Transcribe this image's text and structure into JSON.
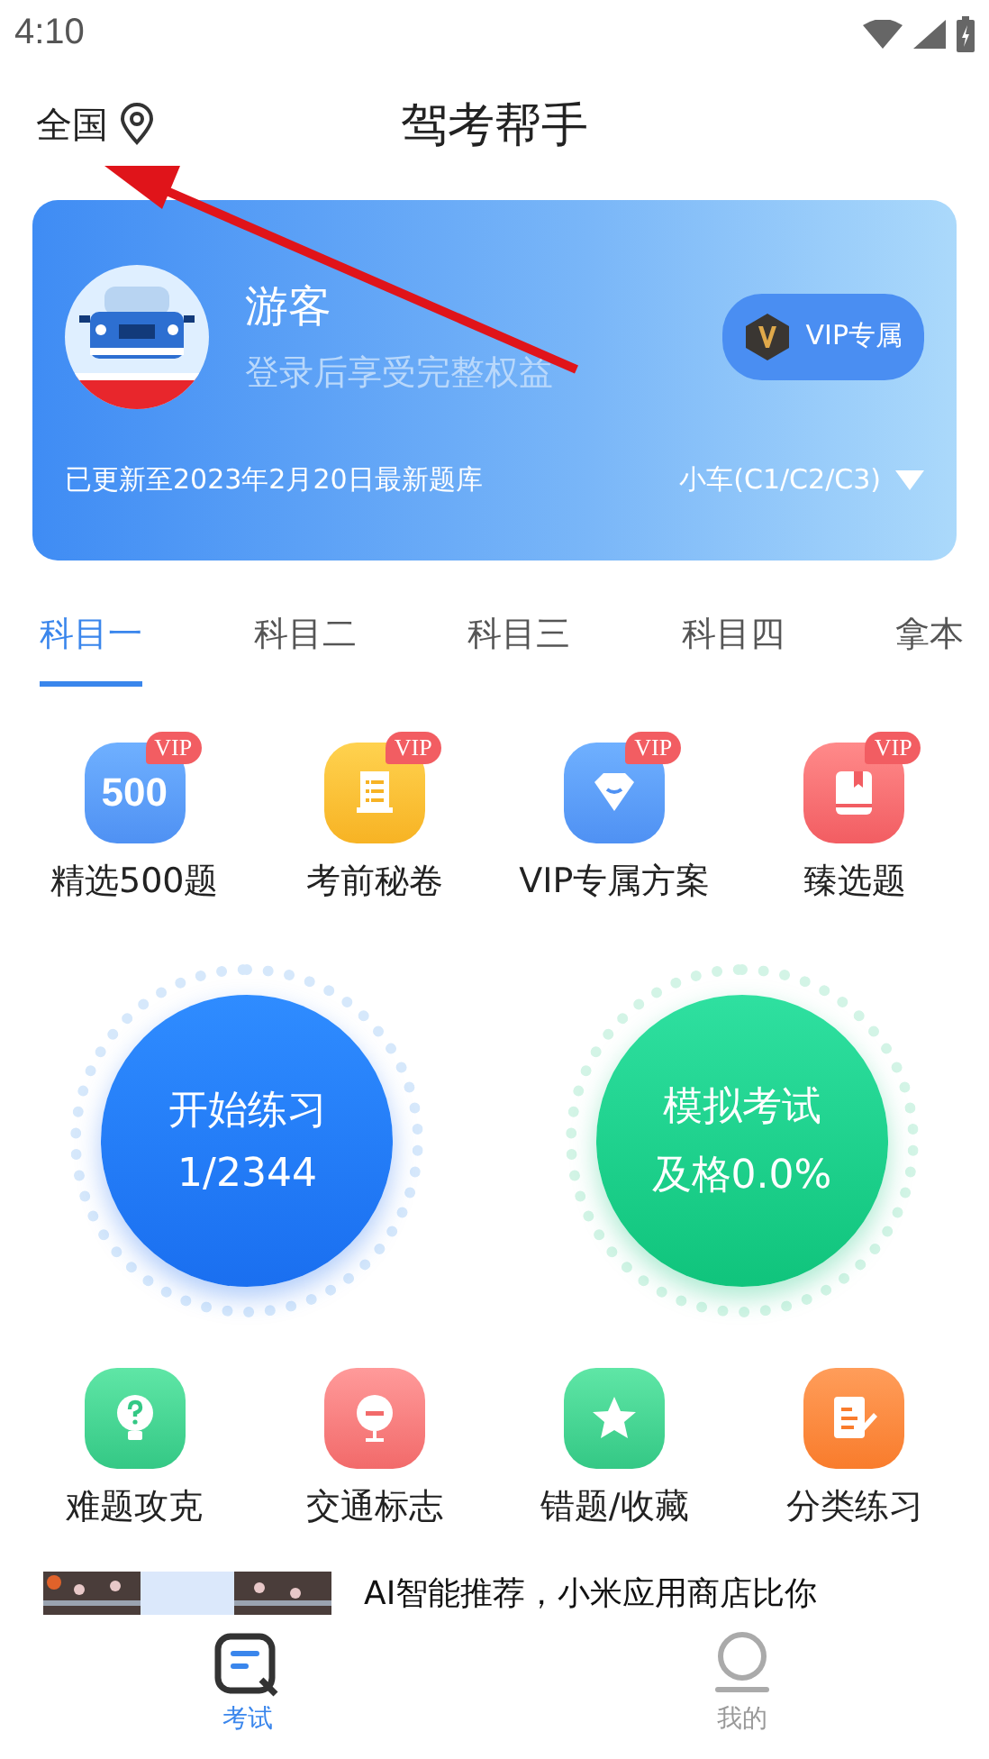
{
  "status_bar": {
    "time": "4:10"
  },
  "header": {
    "location": "全国",
    "title": "驾考帮手"
  },
  "profile": {
    "name": "游客",
    "subtitle": "登录后享受完整权益",
    "vip_button": "VIP专属",
    "update_note": "已更新至2023年2月20日最新题库",
    "vehicle": "小车(C1/C2/C3)"
  },
  "tabs": [
    {
      "label": "科目一",
      "selected": true
    },
    {
      "label": "科目二",
      "selected": false
    },
    {
      "label": "科目三",
      "selected": false
    },
    {
      "label": "科目四",
      "selected": false
    },
    {
      "label": "拿本",
      "selected": false
    }
  ],
  "features": [
    {
      "label": "精选500题",
      "badge": "VIP",
      "kind": "count",
      "icon_text": "500"
    },
    {
      "label": "考前秘卷",
      "badge": "VIP",
      "kind": "scroll"
    },
    {
      "label": "VIP专属方案",
      "badge": "VIP",
      "kind": "diamond"
    },
    {
      "label": "臻选题",
      "badge": "VIP",
      "kind": "book"
    }
  ],
  "practice": [
    {
      "title": "开始练习",
      "detail": "1/2344",
      "kind": "practice"
    },
    {
      "title": "模拟考试",
      "detail": "及格0.0%",
      "kind": "exam"
    }
  ],
  "tools": [
    {
      "label": "难题攻克",
      "kind": "bulb"
    },
    {
      "label": "交通标志",
      "kind": "sign"
    },
    {
      "label": "错题/收藏",
      "kind": "star"
    },
    {
      "label": "分类练习",
      "kind": "edit"
    }
  ],
  "promo": {
    "text": "AI智能推荐，小米应用商店比你"
  },
  "bottom_nav": [
    {
      "label": "考试",
      "selected": true
    },
    {
      "label": "我的",
      "selected": false
    }
  ]
}
